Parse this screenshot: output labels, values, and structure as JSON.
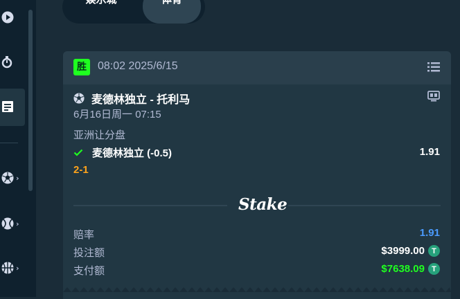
{
  "tabs": {
    "casino": "娱乐城",
    "sport": "体育"
  },
  "sidebar": {
    "items": [
      {
        "icon": "play-circle-icon"
      },
      {
        "icon": "stopwatch-icon"
      },
      {
        "icon": "betslip-icon",
        "active": true
      },
      {
        "icon": "soccer-ball-icon",
        "chevron": "›"
      },
      {
        "icon": "tennis-ball-icon",
        "chevron": "›"
      },
      {
        "icon": "basketball-icon",
        "chevron": "›"
      }
    ]
  },
  "bet": {
    "badge": "胜",
    "placed_at": "08:02 2025/6/15",
    "match": "麦德林独立 - 托利马",
    "match_time": "6月16日周一 07:15",
    "market": "亚洲让分盘",
    "selection": "麦德林独立 (-0.5)",
    "selection_odds": "1.91",
    "score": "2-1",
    "brand": "Stake",
    "odds_label": "赔率",
    "odds_value": "1.91",
    "stake_label": "投注额",
    "stake_value": "$3999.00",
    "payout_label": "支付额",
    "payout_value": "$7638.09",
    "currency_symbol": "T"
  },
  "colors": {
    "win_badge": "#1fff20",
    "score": "#ffa41c",
    "odds": "#4b9bff",
    "payout": "#1fff20",
    "tether": "#26a17b"
  }
}
